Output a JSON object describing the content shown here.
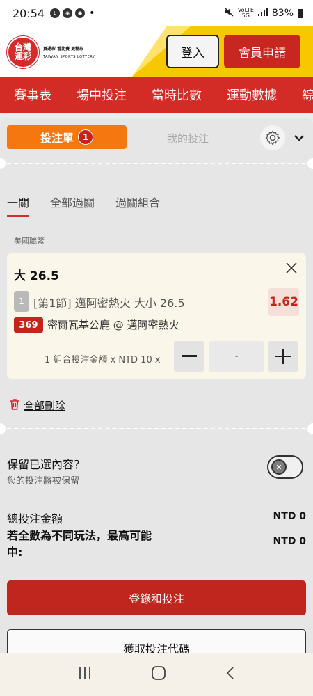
{
  "status_bar": {
    "time": "20:54",
    "signal_small": "Vo) 5G\nLTE1 ↓↑",
    "battery": "83%"
  },
  "header": {
    "logo_top": "台灣",
    "logo_bottom": "運彩",
    "logo_tagline": "買運彩 看比賽 更精彩",
    "logo_english": "TAIWAN SPORTS LOTTERY",
    "login_label": "登入",
    "register_label": "會員申請"
  },
  "nav": {
    "items": [
      "賽事表",
      "場中投注",
      "當時比數",
      "運動數據",
      "綜"
    ]
  },
  "betslip": {
    "tab_betslip": "投注單",
    "betslip_count": "1",
    "tab_mybets": "我的投注",
    "sub_tabs": [
      "一關",
      "全部過關",
      "過關組合"
    ],
    "league": "美國職籃",
    "bet": {
      "title": "大 26.5",
      "period_num": "1",
      "description": "[第1節] 邁阿密熱火 大小 26.5",
      "odds": "1.62",
      "game_number": "369",
      "match": "密爾瓦基公鹿 @ 邁阿密熱火",
      "stake_label": "1 組合投注金額 x NTD 10 x",
      "stake_value": "-"
    },
    "delete_all": "全部刪除",
    "keep": {
      "title": "保留已選內容？",
      "subtitle": "您的投注將被保留"
    },
    "total_label": "總投注金額",
    "total_value": "NTD 0",
    "max_win_label": "若全數為不同玩法，最高可能中:",
    "max_win_value": "NTD 0",
    "login_bet_button": "登錄和投注",
    "get_code_button": "獲取投注代碼"
  },
  "colors": {
    "brand_red": "#d32b26",
    "orange": "#f4780f",
    "yellow": "#f7c800"
  }
}
